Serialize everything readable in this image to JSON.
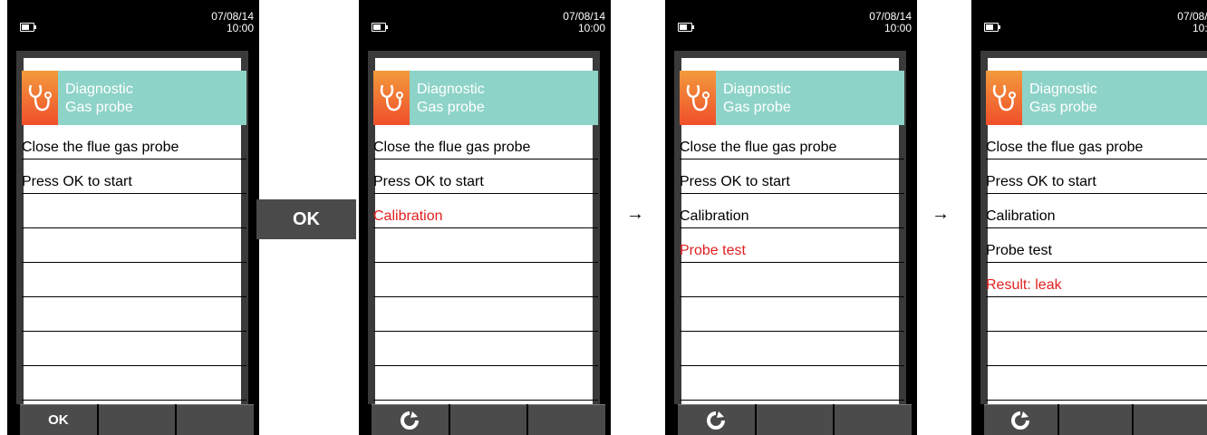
{
  "status": {
    "date": "07/08/14",
    "time": "10:00"
  },
  "header": {
    "title": "Diagnostic",
    "subtitle": "Gas probe"
  },
  "screens": [
    {
      "rows": [
        "Close the flue gas probe",
        "Press OK to start",
        "",
        "",
        "",
        "",
        "",
        ""
      ],
      "active_index": null,
      "softkey_left": "OK"
    },
    {
      "rows": [
        "Close the flue gas probe",
        "Press OK to start",
        "Calibration",
        "",
        "",
        "",
        "",
        ""
      ],
      "active_index": 2,
      "softkey_left_icon": "refresh-icon"
    },
    {
      "rows": [
        "Close the flue gas probe",
        "Press OK to start",
        "Calibration",
        "Probe test",
        "",
        "",
        "",
        ""
      ],
      "active_index": 3,
      "softkey_left_icon": "refresh-icon"
    },
    {
      "rows": [
        "Close the flue gas probe",
        "Press OK to start",
        "Calibration",
        "Probe test",
        "Result: leak",
        "",
        "",
        ""
      ],
      "active_index": 4,
      "softkey_left_icon": "refresh-icon"
    }
  ],
  "transition": {
    "ok_label": "OK",
    "arrow": "→"
  },
  "colors": {
    "accent_teal": "#8ed3c8",
    "icon_orange": "#f39a3c",
    "active_text": "#e02020"
  }
}
